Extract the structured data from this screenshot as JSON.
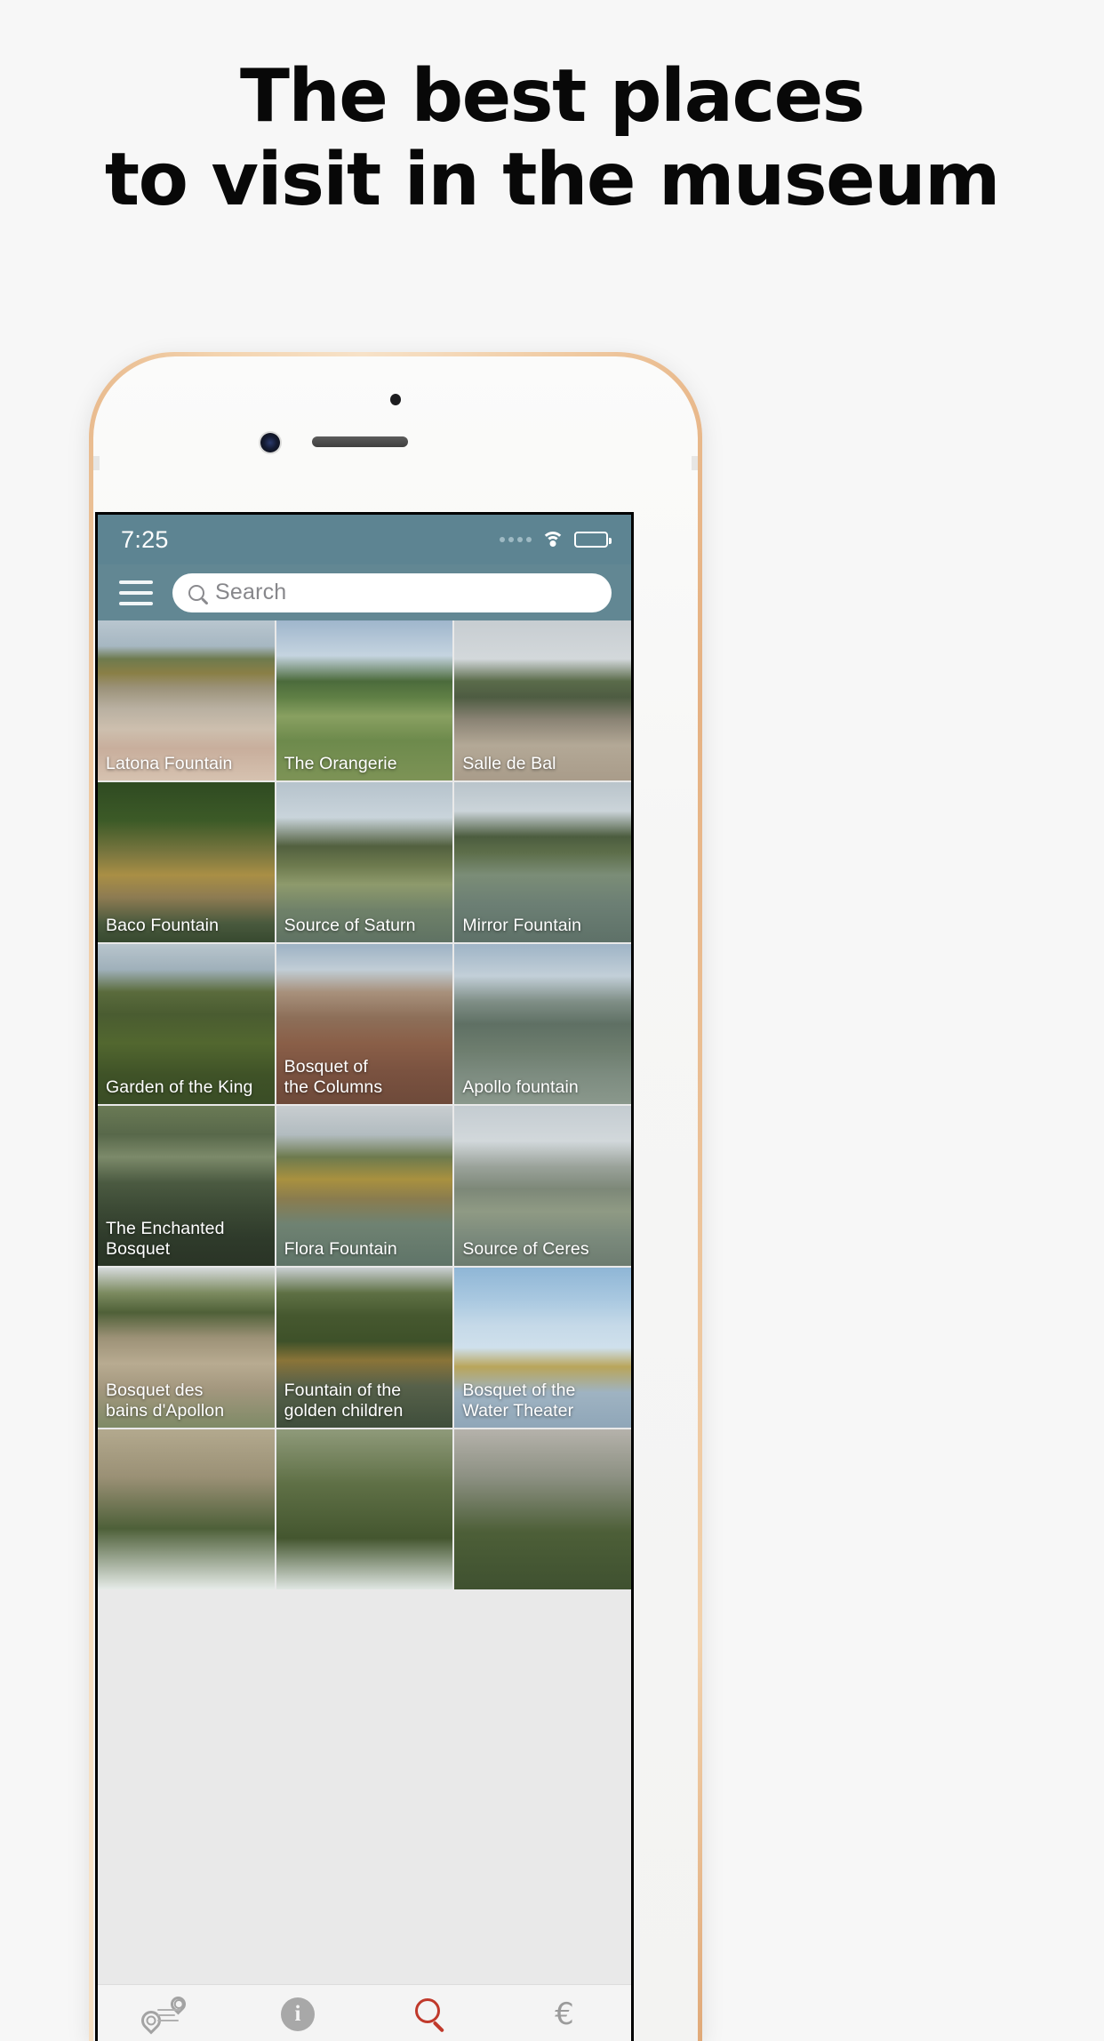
{
  "headline": {
    "line1": "The best places",
    "line2": "to visit in the museum"
  },
  "phone": {
    "bezel_color": "#f0cba3",
    "front_color": "#f6f6f5",
    "sensors": {
      "proximity": "proximity-sensor",
      "camera": "front-camera",
      "speaker": "earpiece-speaker"
    }
  },
  "screen": {
    "statusbar": {
      "time": "7:25",
      "background": "#5d8492",
      "signal_dots": 4,
      "wifi": "wifi-icon",
      "battery": "battery-icon",
      "battery_level": "85"
    },
    "navbar": {
      "background": "#628793",
      "menu": "hamburger-menu",
      "search": {
        "placeholder": "Search",
        "value": ""
      }
    },
    "grid": {
      "tiles": [
        {
          "label": "Latona Fountain",
          "art": "latona"
        },
        {
          "label": "The Orangerie",
          "art": "orangerie"
        },
        {
          "label": "Salle de Bal",
          "art": "salledebal"
        },
        {
          "label": "Baco Fountain",
          "art": "baco"
        },
        {
          "label": "Source of Saturn",
          "art": "saturn"
        },
        {
          "label": "Mirror Fountain",
          "art": "mirror"
        },
        {
          "label": "Garden of the King",
          "art": "gardenking"
        },
        {
          "label": "Bosquet of\nthe Columns",
          "art": "columns"
        },
        {
          "label": "Apollo fountain",
          "art": "apollo"
        },
        {
          "label": "The Enchanted\nBosquet",
          "art": "enchanted"
        },
        {
          "label": "Flora Fountain",
          "art": "flora"
        },
        {
          "label": "Source of Ceres",
          "art": "ceres"
        },
        {
          "label": "Bosquet des\nbains d'Apollon",
          "art": "bains"
        },
        {
          "label": "Fountain of the\ngolden children",
          "art": "goldenchildren"
        },
        {
          "label": "Bosquet of the\nWater Theater",
          "art": "watertheater"
        },
        {
          "label": "",
          "art": "partial1"
        },
        {
          "label": "",
          "art": "partial2"
        },
        {
          "label": "",
          "art": "partial3"
        }
      ]
    },
    "tabbar": {
      "background": "#f4f4f4",
      "active_color": "#c0392b",
      "inactive_color": "#a3a3a3",
      "items": [
        {
          "icon": "route-map-icon",
          "active": false
        },
        {
          "icon": "info-icon",
          "active": false,
          "glyph": "i"
        },
        {
          "icon": "search-icon",
          "active": true
        },
        {
          "icon": "euro-icon",
          "active": false,
          "glyph": "€"
        }
      ]
    }
  }
}
